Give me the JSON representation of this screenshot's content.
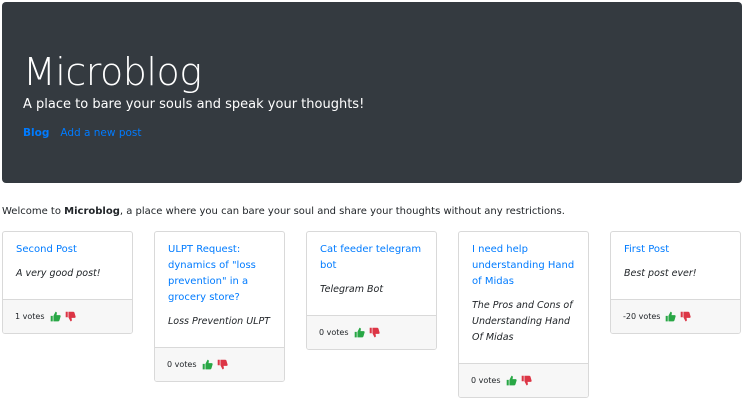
{
  "header": {
    "title": "Microblog",
    "tagline": "A place to bare your souls and speak your thoughts!",
    "nav": [
      {
        "label": "Blog",
        "active": true
      },
      {
        "label": "Add a new post",
        "active": false
      }
    ]
  },
  "welcome": {
    "prefix": "Welcome to ",
    "brand": "Microblog",
    "suffix": ", a place where you can bare your soul and share your thoughts without any restrictions."
  },
  "posts": [
    {
      "title": "Second Post",
      "summary": "A very good post!",
      "votes": "1 votes"
    },
    {
      "title": "ULPT Request: dynamics of \"loss prevention\" in a grocery store?",
      "summary": "Loss Prevention ULPT",
      "votes": "0 votes"
    },
    {
      "title": "Cat feeder telegram bot",
      "summary": "Telegram Bot",
      "votes": "0 votes"
    },
    {
      "title": "I need help understanding Hand of Midas",
      "summary": "The Pros and Cons of Understanding Hand Of Midas",
      "votes": "0 votes"
    },
    {
      "title": "First Post",
      "summary": "Best post ever!",
      "votes": "-20 votes"
    }
  ],
  "colors": {
    "header_bg": "#343a40",
    "link": "#007bff",
    "upvote": "#28a745",
    "downvote": "#dc3545"
  },
  "icons": {
    "upvote": "thumbs-up-icon",
    "downvote": "thumbs-down-icon"
  }
}
